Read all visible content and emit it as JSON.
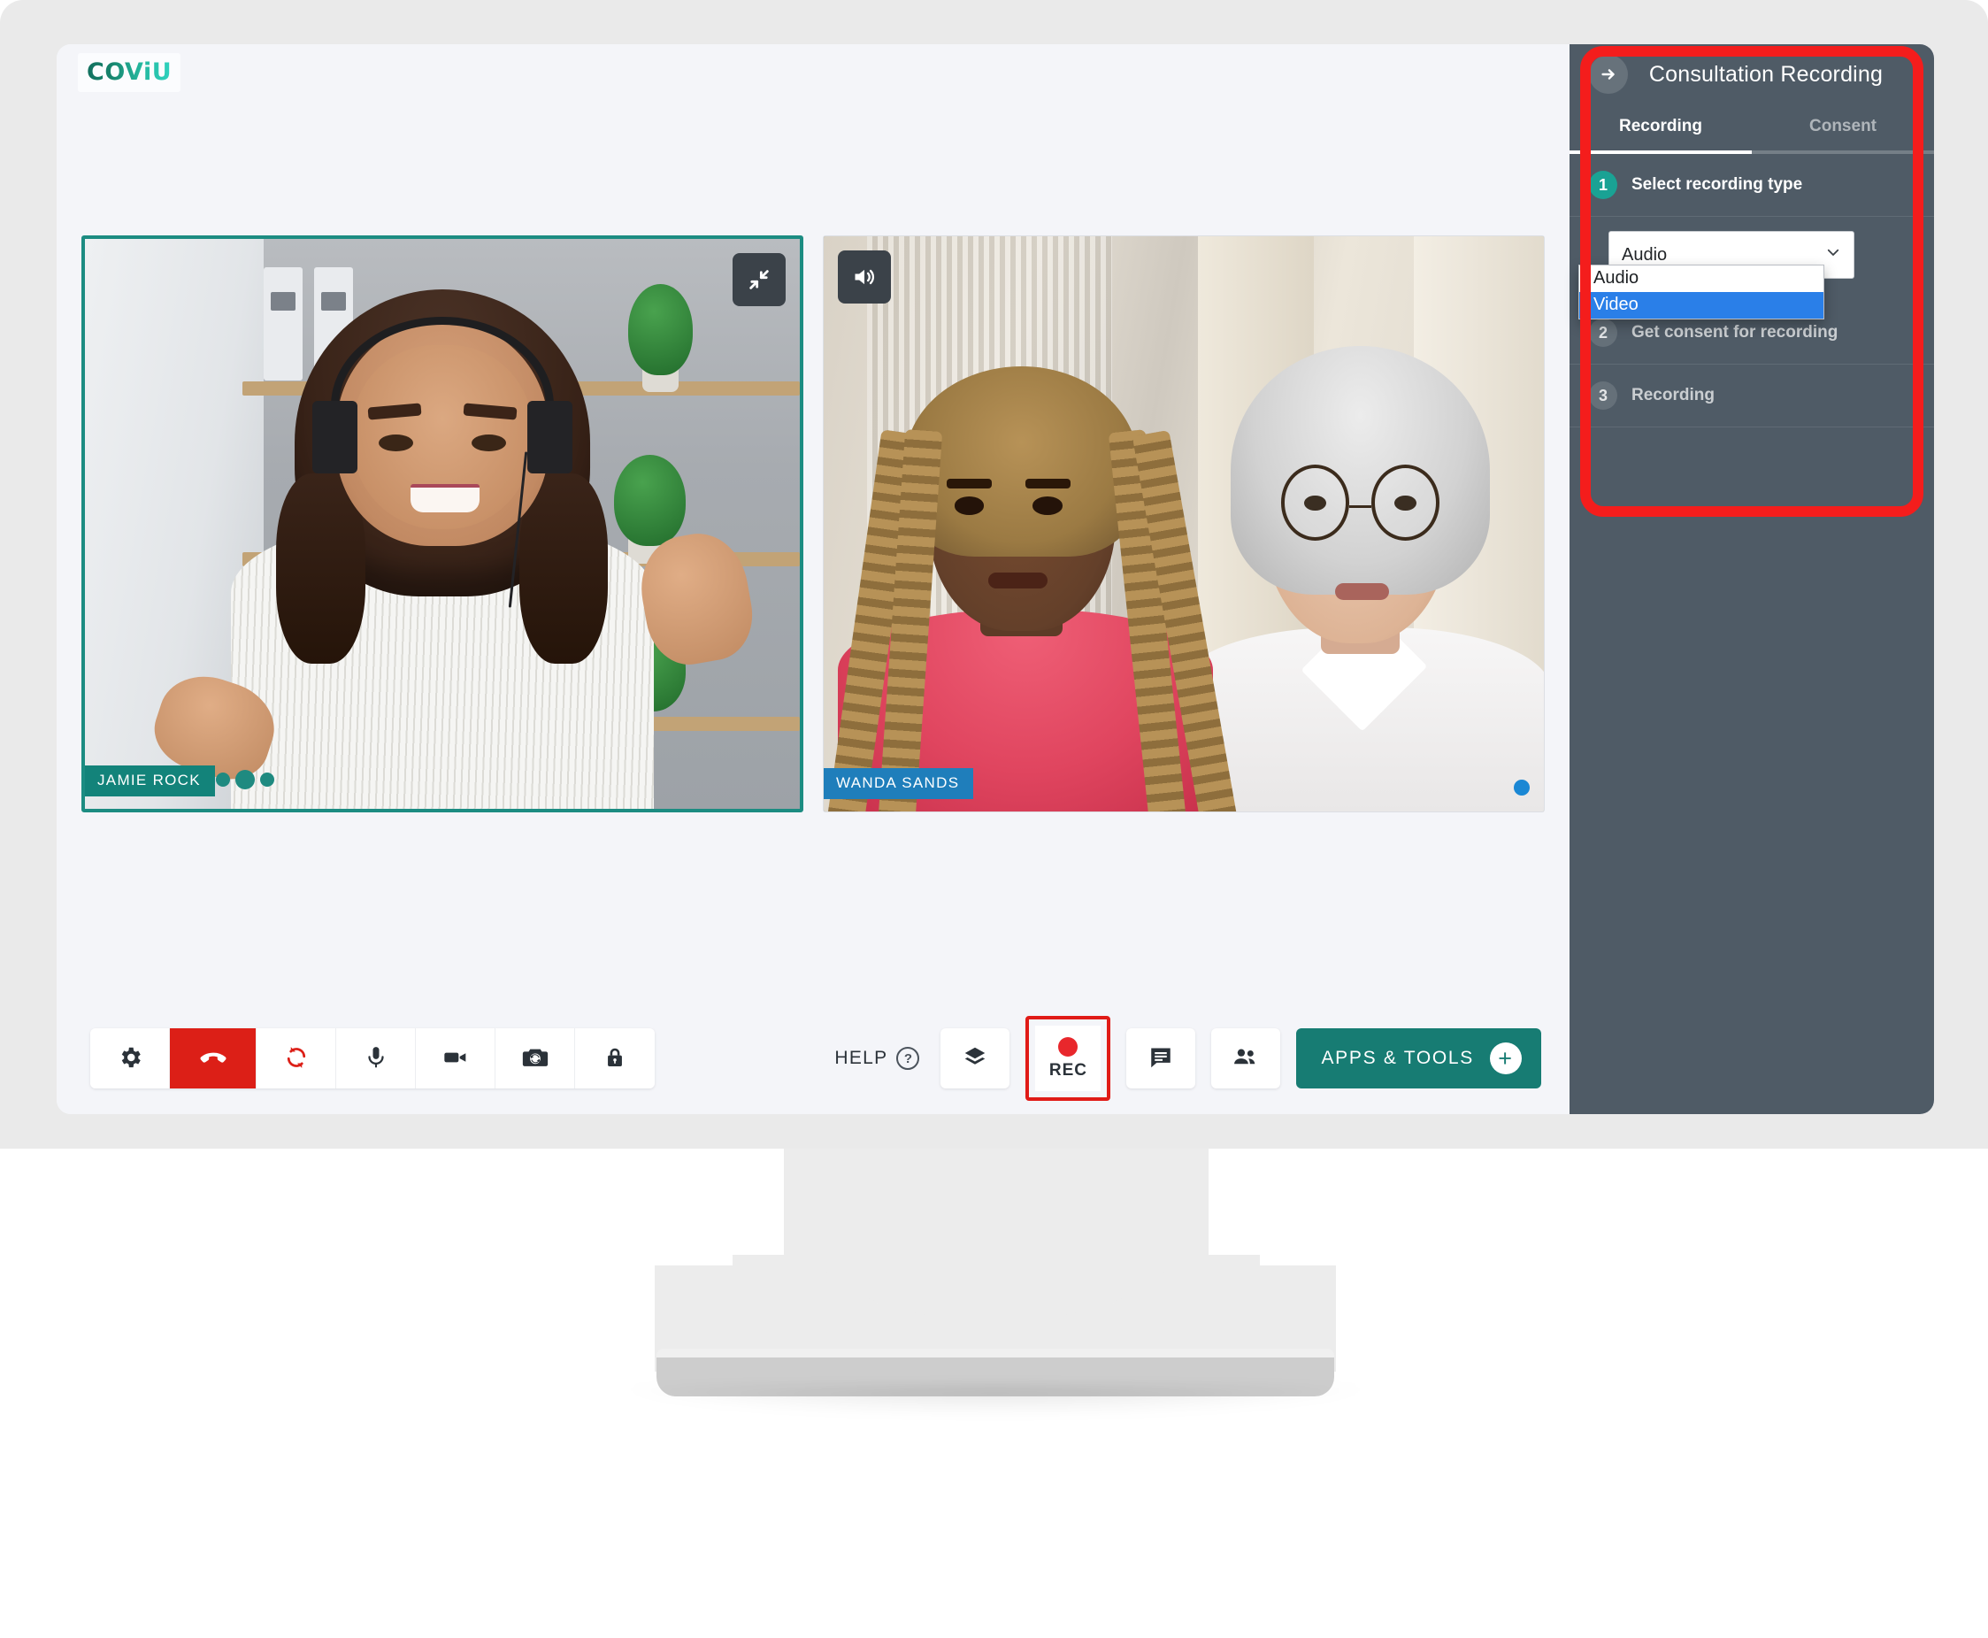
{
  "brand": {
    "name": "COViU"
  },
  "tiles": [
    {
      "name": "JAMIE ROCK",
      "control_icon": "collapse-arrows-icon",
      "indicator": "connection-dots"
    },
    {
      "name": "WANDA SANDS",
      "control_icon": "speaker-icon",
      "indicator": "blue-status-dot"
    }
  ],
  "toolbar": {
    "left_buttons": [
      {
        "name": "settings",
        "icon": "gear-icon"
      },
      {
        "name": "end-call",
        "icon": "hangup-phone-icon"
      },
      {
        "name": "refresh",
        "icon": "refresh-icon"
      },
      {
        "name": "microphone",
        "icon": "microphone-icon"
      },
      {
        "name": "camera",
        "icon": "video-camera-icon"
      },
      {
        "name": "switch-camera",
        "icon": "camera-switch-icon"
      },
      {
        "name": "lock-room",
        "icon": "lock-icon"
      }
    ],
    "help_label": "HELP",
    "help_icon": "question-mark-icon",
    "layout_icon": "layers-icon",
    "record_label": "REC",
    "record_icon": "record-dot-icon",
    "chat_icon": "chat-bubble-icon",
    "participants_icon": "people-icon",
    "apps_label": "APPS & TOOLS",
    "apps_plus": "+"
  },
  "side_panel": {
    "back_icon": "arrow-right-icon",
    "title": "Consultation Recording",
    "tabs": [
      {
        "label": "Recording",
        "active": true
      },
      {
        "label": "Consent",
        "active": false
      }
    ],
    "steps": [
      {
        "number": "1",
        "label": "Select recording type",
        "active": true
      },
      {
        "number": "2",
        "label": "Get consent for recording",
        "active": false
      },
      {
        "number": "3",
        "label": "Recording",
        "active": false
      }
    ],
    "recording_type_select": {
      "value": "Audio",
      "expanded": true,
      "options": [
        {
          "label": "Audio",
          "selected": false
        },
        {
          "label": "Video",
          "selected": true
        }
      ]
    }
  },
  "colors": {
    "accent_teal": "#177c73",
    "panel_bg": "#4f5b66",
    "highlight_red": "#f41d1c",
    "danger_red": "#dc1f17",
    "record_red": "#e8272c",
    "select_highlight_blue": "#2a7fe8",
    "self_tile_border": "#1c8c82",
    "name_tag_blue": "#1f7ebb"
  }
}
